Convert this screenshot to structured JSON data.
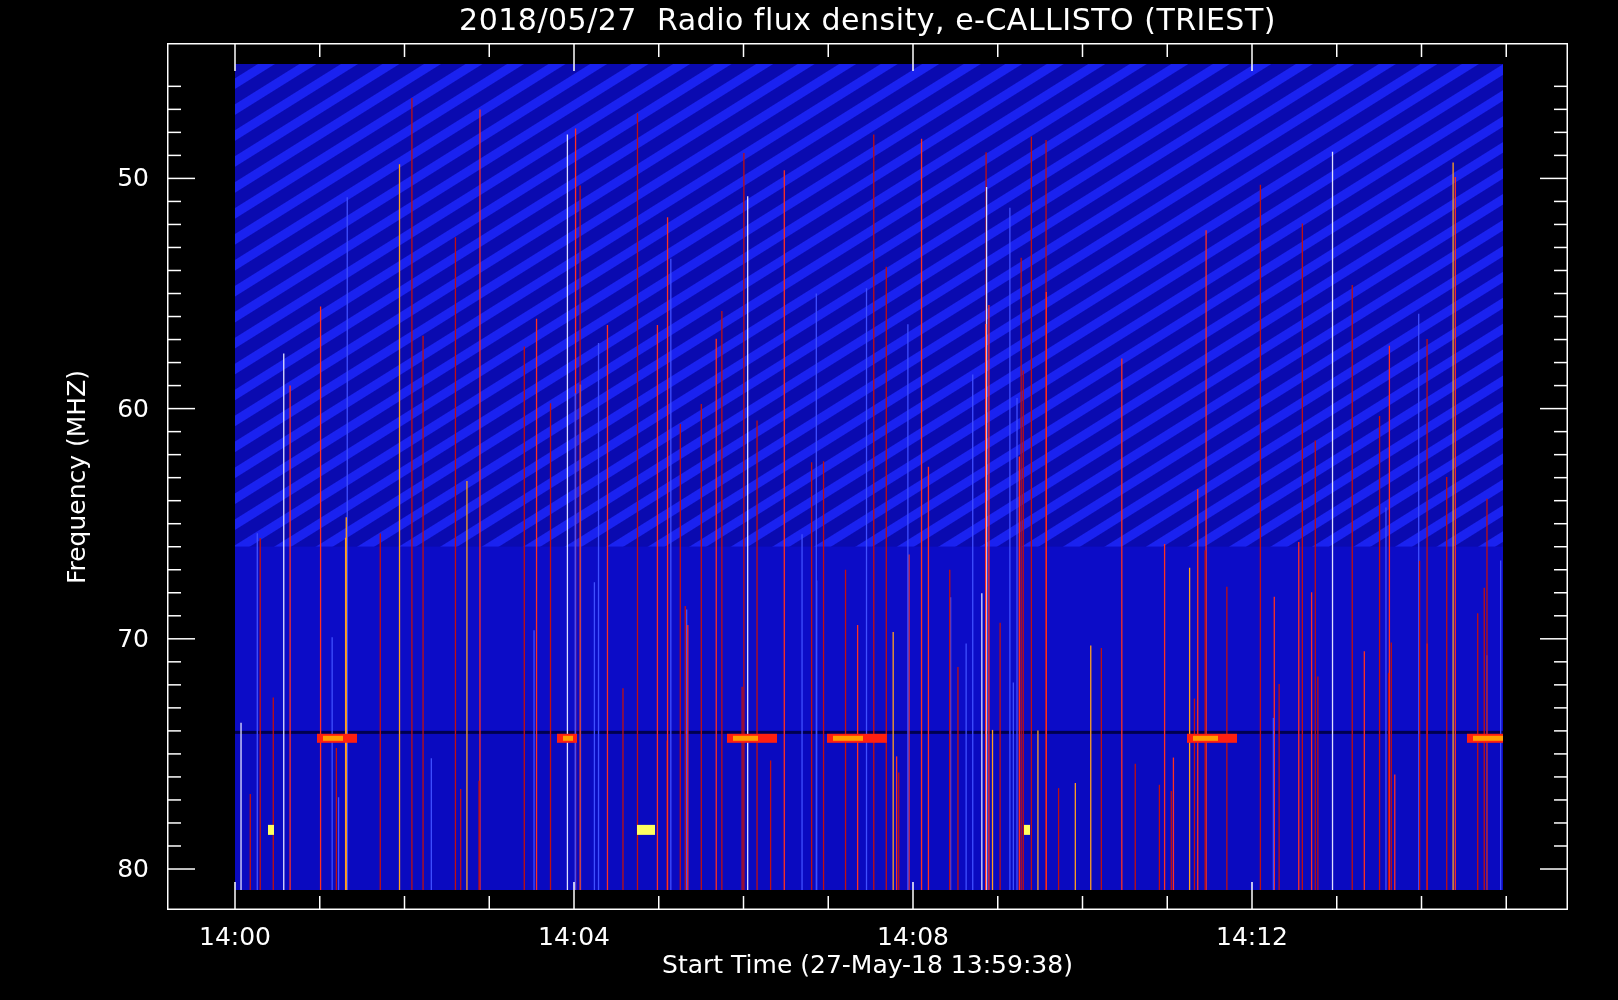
{
  "title": "2018/05/27  Radio flux density, e-CALLISTO (TRIEST)",
  "y_axis": {
    "label": "Frequency (MHZ)",
    "ticks": [
      "50",
      "60",
      "70",
      "80"
    ]
  },
  "x_axis": {
    "label": "Start Time (27-May-18 13:59:38)",
    "ticks": [
      "14:00",
      "14:04",
      "14:08",
      "14:12"
    ]
  }
}
